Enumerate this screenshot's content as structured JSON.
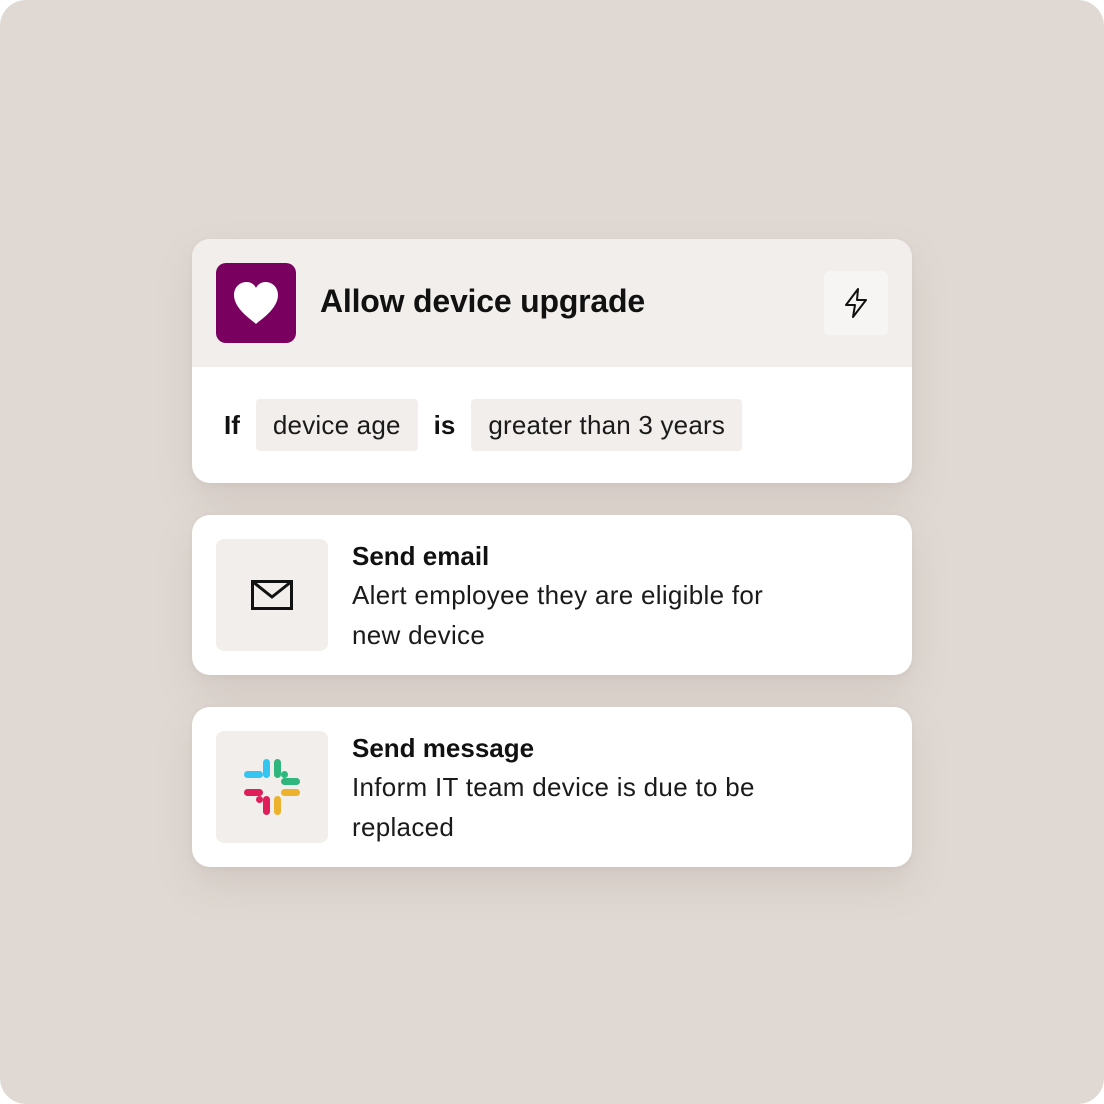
{
  "trigger": {
    "title": "Allow device upgrade",
    "icon": "heart-icon",
    "icon_bg_color": "#7a0060",
    "action_icon": "lightning-bolt-icon",
    "condition": {
      "if_label": "If",
      "field": "device age",
      "operator": "is",
      "value": "greater than 3 years"
    }
  },
  "actions": [
    {
      "title": "Send email",
      "description": "Alert employee they are eligible for new device",
      "icon": "mail-icon"
    },
    {
      "title": "Send message",
      "description": "Inform IT team device is due to be replaced",
      "icon": "slack-icon"
    }
  ],
  "colors": {
    "background": "#e0d9d3",
    "card": "#ffffff",
    "header_bg": "#f1eeeb",
    "brand": "#7a0060"
  }
}
